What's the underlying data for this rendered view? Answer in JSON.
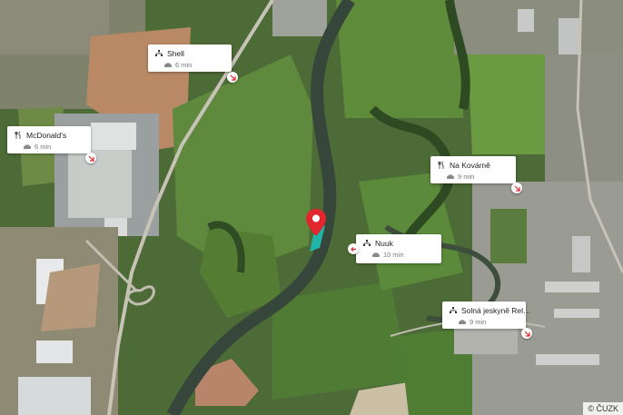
{
  "map": {
    "attribution": "© ČUZK",
    "colors": {
      "pin": "#e1262d",
      "marker": "#1fb5a9",
      "river": "#3c4a3a",
      "field": "#b98965"
    }
  },
  "places": [
    {
      "name": "Shell",
      "category_icon": "fuel-station-icon",
      "travel_icon": "car-icon",
      "travel_time": "6 min"
    },
    {
      "name": "McDonald's",
      "category_icon": "restaurant-icon",
      "travel_icon": "car-icon",
      "travel_time": "6 min"
    },
    {
      "name": "Na Kovárně",
      "category_icon": "restaurant-icon",
      "travel_icon": "car-icon",
      "travel_time": "9 min"
    },
    {
      "name": "Nuuk",
      "category_icon": "hierarchy-icon",
      "travel_icon": "car-icon",
      "travel_time": "10 min"
    },
    {
      "name": "Solná jeskyně Rel…",
      "category_icon": "hierarchy-icon",
      "travel_icon": "car-icon",
      "travel_time": "9 min"
    }
  ]
}
